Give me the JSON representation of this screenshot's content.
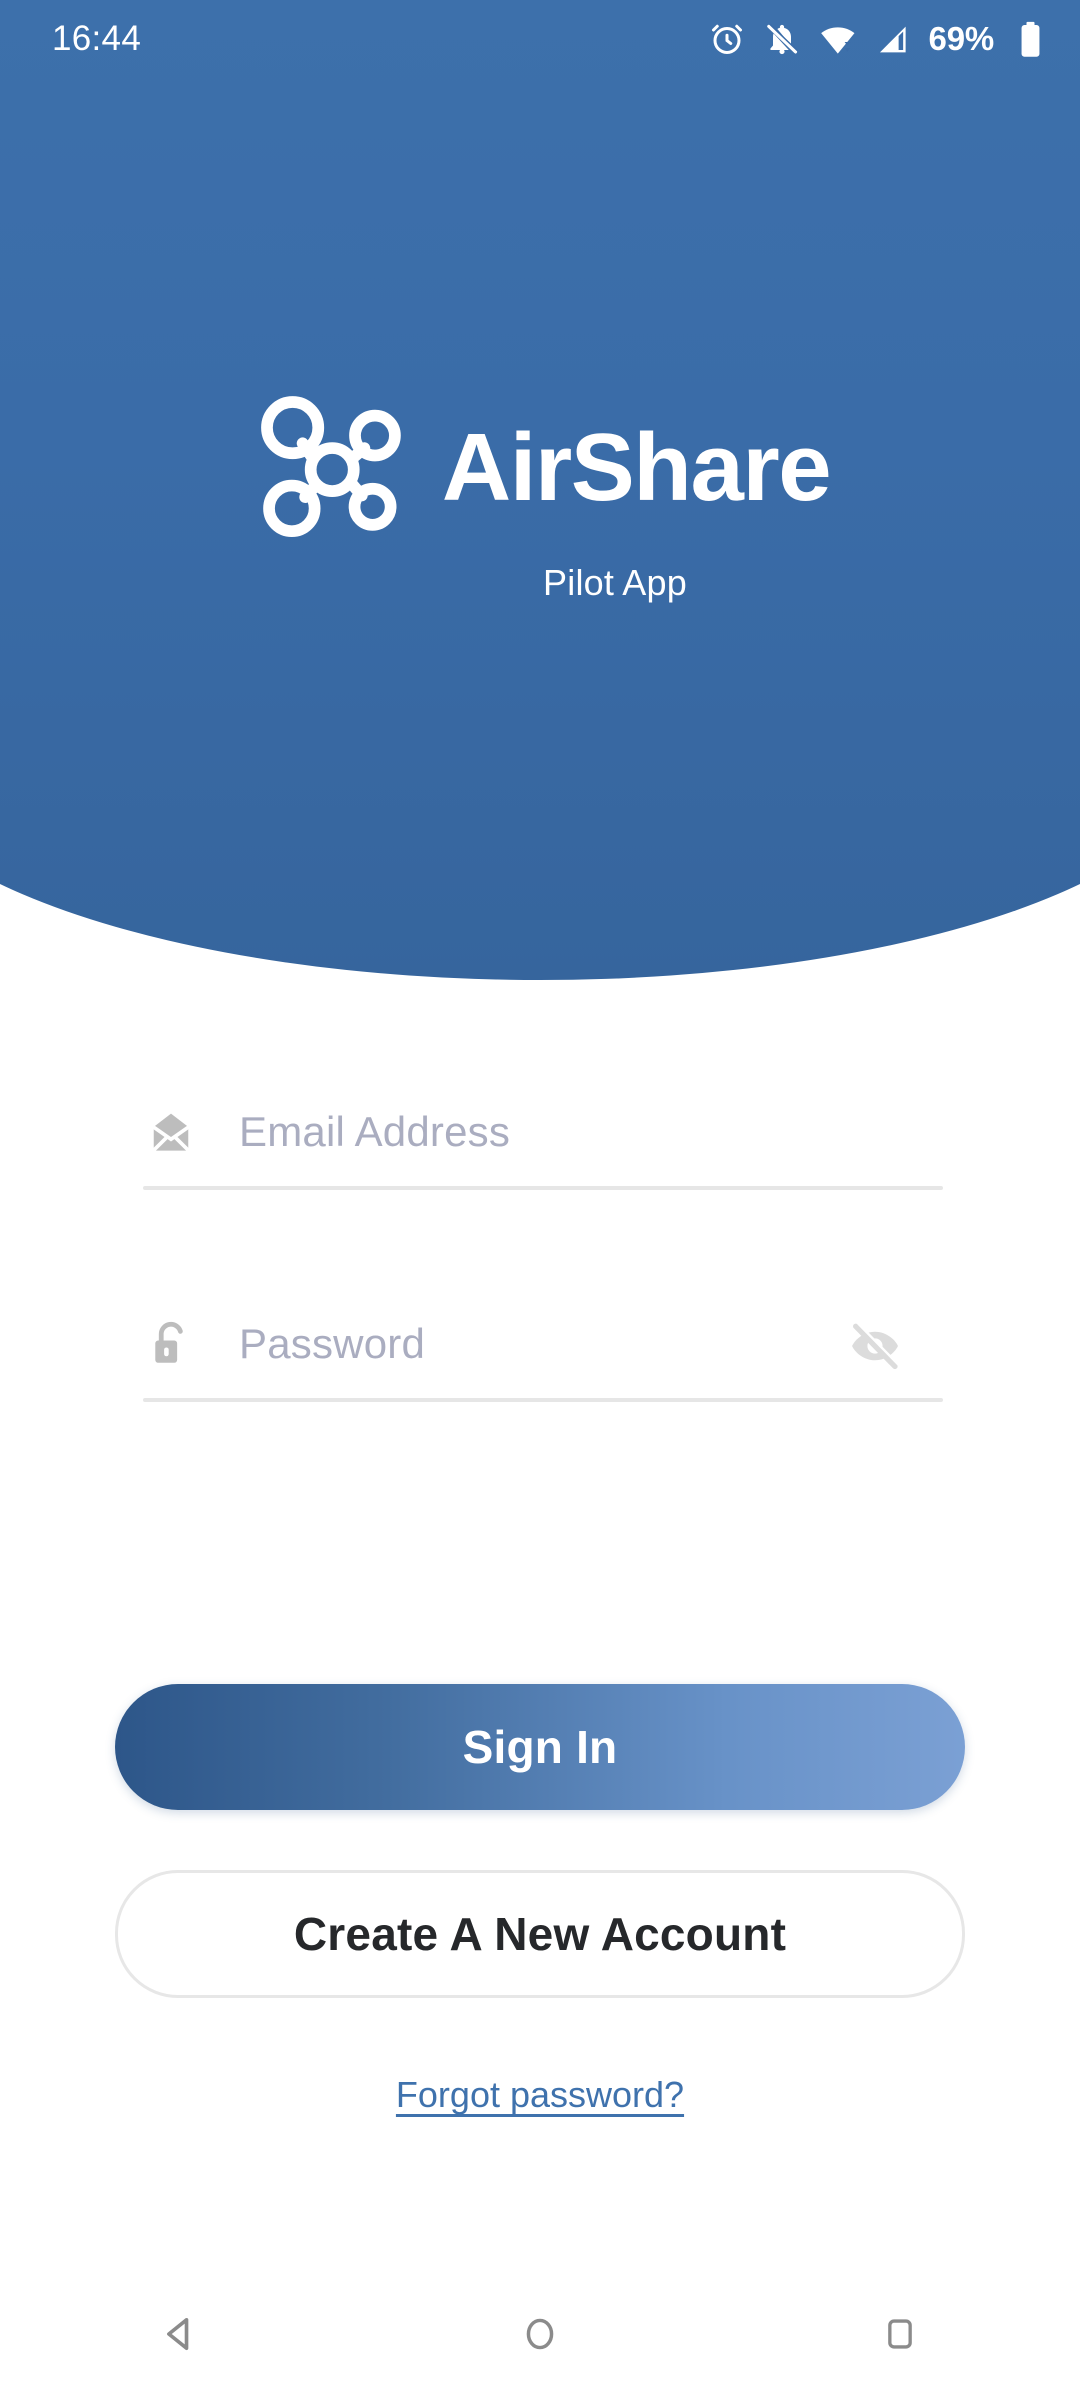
{
  "status_bar": {
    "time": "16:44",
    "battery_percent": "69%",
    "icons": [
      "alarm-icon",
      "notifications-off-icon",
      "wifi-icon",
      "cellular-signal-icon",
      "battery-icon"
    ]
  },
  "brand": {
    "logo_icon": "drone-logo-icon",
    "title": "AirShare",
    "subtitle": "Pilot App"
  },
  "form": {
    "email": {
      "icon": "email-icon",
      "placeholder": "Email Address",
      "value": ""
    },
    "password": {
      "icon": "lock-icon",
      "placeholder": "Password",
      "value": "",
      "toggle_icon": "eye-off-icon"
    }
  },
  "actions": {
    "sign_in_label": "Sign In",
    "create_account_label": "Create A New Account",
    "forgot_password_label": "Forgot password?"
  },
  "nav_bar": {
    "back": "back-nav-icon",
    "home": "home-nav-icon",
    "recents": "recents-nav-icon"
  },
  "colors": {
    "header_blue": "#3a6ca8",
    "header_blue_dark": "#36659d",
    "primary_gradient_start": "#2d5689",
    "primary_gradient_end": "#7ba0d4",
    "placeholder": "#aaadc0",
    "underline": "#e6e6e6",
    "link_blue": "#3f72ad",
    "icon_gray": "#bdbdbd",
    "nav_gray": "#8b8b8b"
  }
}
